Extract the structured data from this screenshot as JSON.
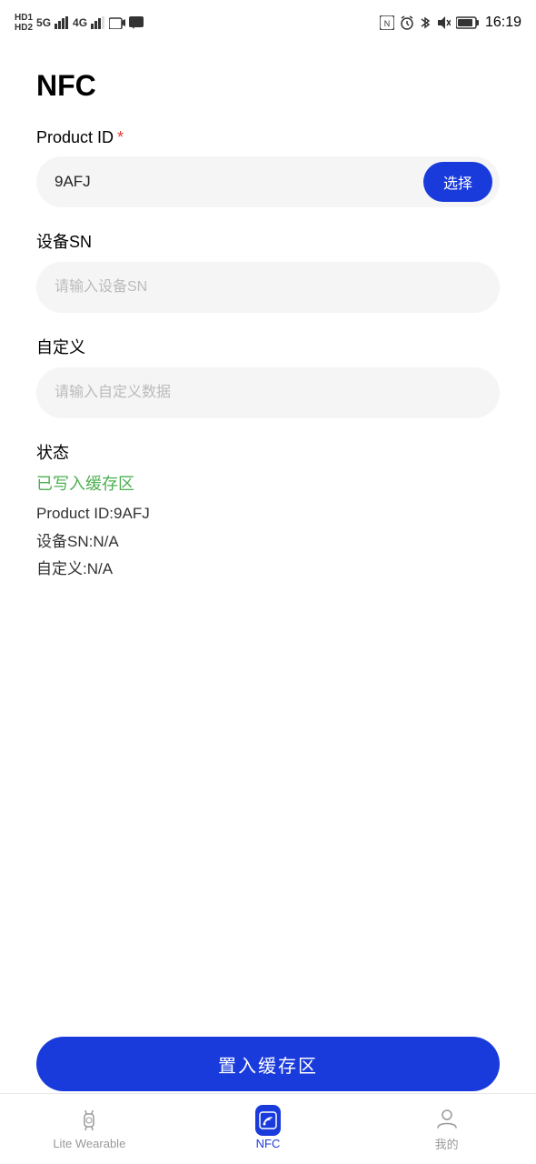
{
  "statusBar": {
    "time": "16:19",
    "icons": [
      "HD1",
      "HD2",
      "5G",
      "4G",
      "signal",
      "camera",
      "message",
      "NFC",
      "alarm",
      "bluetooth",
      "mute",
      "battery"
    ]
  },
  "page": {
    "title": "NFC"
  },
  "form": {
    "productId": {
      "label": "Product ID",
      "required": true,
      "value": "9AFJ",
      "selectBtn": "选择"
    },
    "deviceSN": {
      "label": "设备SN",
      "placeholder": "请输入设备SN",
      "value": ""
    },
    "custom": {
      "label": "自定义",
      "placeholder": "请输入自定义数据",
      "value": ""
    }
  },
  "status": {
    "label": "状态",
    "writtenText": "已写入缓存区",
    "productIdDetail": "Product ID:9AFJ",
    "deviceSNDetail": "设备SN:N/A",
    "customDetail": "自定义:N/A"
  },
  "bottomButton": {
    "label": "置入缓存区"
  },
  "bottomNav": {
    "items": [
      {
        "id": "lite-wearable",
        "label": "Lite Wearable",
        "active": false
      },
      {
        "id": "nfc",
        "label": "NFC",
        "active": true
      },
      {
        "id": "mine",
        "label": "我的",
        "active": false
      }
    ]
  }
}
